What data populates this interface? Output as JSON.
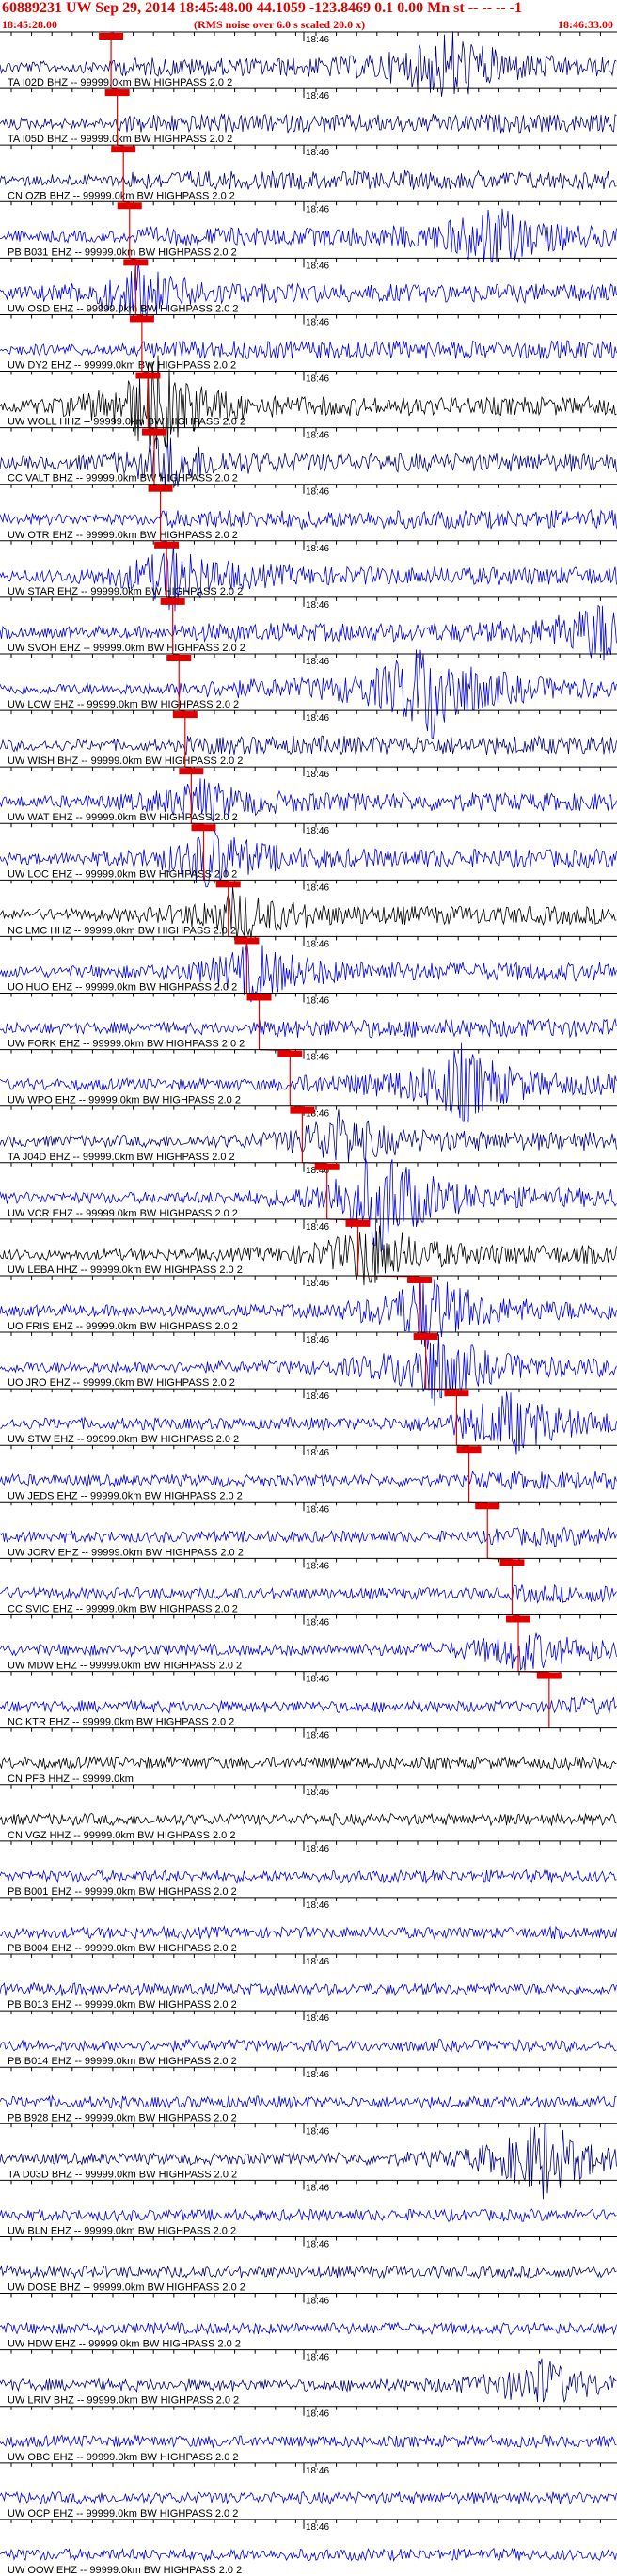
{
  "header": {
    "title": "60889231 UW Sep 29, 2014 18:45:48.00   44.1059 -123.8469  0.1 0.00 Mn st -- -- --  -1",
    "start_time": "18:45:28.00",
    "noise_note": "(RMS noise over 6.0 s scaled 20.0 x)",
    "end_time": "18:46:33.00",
    "tick_label": "18:46",
    "colors": {
      "header_text": "#e00000",
      "pick_marker": "#e00000"
    }
  },
  "traces": [
    {
      "label": "TA I02D BHZ -- 99999.0km BW  HIGHPASS  2.0  2",
      "color": "#000080",
      "pick": 0.18,
      "burst": 0.73,
      "burstAmp": 1.8
    },
    {
      "label": "TA I05D BHZ -- 99999.0km BW  HIGHPASS  2.0  2",
      "color": "#000080",
      "pick": 0.19,
      "burst": null,
      "burstAmp": 0
    },
    {
      "label": "CN OZB BHZ -- 99999.0km BW  HIGHPASS  2.0  2",
      "color": "#000080",
      "pick": 0.2,
      "burst": null,
      "burstAmp": 0
    },
    {
      "label": "PB B031 EHZ -- 99999.0km BW  HIGHPASS  2.0  2",
      "color": "#0000e0",
      "pick": 0.21,
      "burst": 0.8,
      "burstAmp": 1.5
    },
    {
      "label": "UW OSD EHZ -- 99999.0km BW  HIGHPASS  2.0  2",
      "color": "#0000e0",
      "pick": 0.22,
      "burst": 0.22,
      "burstAmp": 1.4
    },
    {
      "label": "UW DY2 EHZ -- 99999.0km BW  HIGHPASS  2.0  2",
      "color": "#0000e0",
      "pick": 0.23,
      "burst": null,
      "burstAmp": 0
    },
    {
      "label": "UW WOLL HHZ -- 99999.0km BW  HIGHPASS  2.0  2",
      "color": "#000000",
      "pick": 0.24,
      "burst": 0.25,
      "burstAmp": 2.6
    },
    {
      "label": "CC VALT BHZ -- 99999.0km BW  HIGHPASS  2.0  2",
      "color": "#000080",
      "pick": 0.25,
      "burst": 0.27,
      "burstAmp": 1.2
    },
    {
      "label": "UW OTR EHZ -- 99999.0km BW  HIGHPASS  2.0  2",
      "color": "#0000e0",
      "pick": 0.26,
      "burst": null,
      "burstAmp": 0
    },
    {
      "label": "UW STAR EHZ -- 99999.0km BW  HIGHPASS  2.0  2",
      "color": "#0000e0",
      "pick": 0.27,
      "burst": 0.28,
      "burstAmp": 1.6
    },
    {
      "label": "UW SVOH EHZ -- 99999.0km BW  HIGHPASS  2.0  2",
      "color": "#0000e0",
      "pick": 0.28,
      "burst": 0.98,
      "burstAmp": 1.5
    },
    {
      "label": "UW LCW EHZ -- 99999.0km BW  HIGHPASS  2.0  2",
      "color": "#0000e0",
      "pick": 0.29,
      "burst": 0.7,
      "burstAmp": 2.8
    },
    {
      "label": "UW WISH BHZ -- 99999.0km BW  HIGHPASS  2.0  2",
      "color": "#000080",
      "pick": 0.3,
      "burst": null,
      "burstAmp": 0
    },
    {
      "label": "UW WAT EHZ -- 99999.0km BW  HIGHPASS  2.0  2",
      "color": "#0000e0",
      "pick": 0.31,
      "burst": 0.32,
      "burstAmp": 1.0
    },
    {
      "label": "UW LOC EHZ -- 99999.0km BW  HIGHPASS  2.0  2",
      "color": "#0000e0",
      "pick": 0.33,
      "burst": 0.34,
      "burstAmp": 1.5
    },
    {
      "label": "NC LMC HHZ -- 99999.0km BW  HIGHPASS  2.0  2",
      "color": "#000000",
      "pick": 0.37,
      "burst": 0.38,
      "burstAmp": 1.2
    },
    {
      "label": "UO HUO EHZ -- 99999.0km BW  HIGHPASS  2.0  2",
      "color": "#0000e0",
      "pick": 0.4,
      "burst": 0.41,
      "burstAmp": 1.4
    },
    {
      "label": "UW FORK EHZ -- 99999.0km BW  HIGHPASS  2.0  2",
      "color": "#0000e0",
      "pick": 0.42,
      "burst": null,
      "burstAmp": 0
    },
    {
      "label": "UW WPO EHZ -- 99999.0km BW  HIGHPASS  2.0  2",
      "color": "#0000e0",
      "pick": 0.47,
      "burst": 0.75,
      "burstAmp": 1.9
    },
    {
      "label": "TA J04D BHZ -- 99999.0km BW  HIGHPASS  2.0  2",
      "color": "#000080",
      "pick": 0.49,
      "burst": 0.55,
      "burstAmp": 1.3
    },
    {
      "label": "UW VCR EHZ -- 99999.0km BW  HIGHPASS  2.0  2",
      "color": "#0000e0",
      "pick": 0.53,
      "burst": 0.62,
      "burstAmp": 2.8
    },
    {
      "label": "UW LEBA HHZ -- 99999.0km BW  HIGHPASS  2.0  2",
      "color": "#000000",
      "pick": 0.58,
      "burst": 0.6,
      "burstAmp": 1.6
    },
    {
      "label": "UO FRIS EHZ -- 99999.0km BW  HIGHPASS  2.0  2",
      "color": "#0000e0",
      "pick": 0.68,
      "burst": 0.69,
      "burstAmp": 2.0
    },
    {
      "label": "UO JRO EHZ -- 99999.0km BW  HIGHPASS  2.0  2",
      "color": "#0000e0",
      "pick": 0.69,
      "burst": 0.7,
      "burstAmp": 2.0
    },
    {
      "label": "UW STW EHZ -- 99999.0km BW  HIGHPASS  2.0  2",
      "color": "#0000e0",
      "pick": 0.74,
      "burst": 0.83,
      "burstAmp": 1.5
    },
    {
      "label": "UW JEDS EHZ -- 99999.0km BW  HIGHPASS  2.0  2",
      "color": "#0000e0",
      "pick": 0.76,
      "burst": null,
      "burstAmp": 0
    },
    {
      "label": "UW JORV EHZ -- 99999.0km BW  HIGHPASS  2.0  2",
      "color": "#0000e0",
      "pick": 0.79,
      "burst": null,
      "burstAmp": 0
    },
    {
      "label": "CC SVIC EHZ -- 99999.0km BW  HIGHPASS  2.0  2",
      "color": "#0000e0",
      "pick": 0.83,
      "burst": null,
      "burstAmp": 0
    },
    {
      "label": "UW MDW EHZ -- 99999.0km BW  HIGHPASS  2.0  2",
      "color": "#0000e0",
      "pick": 0.84,
      "burst": 0.84,
      "burstAmp": 0.9
    },
    {
      "label": "NC KTR EHZ -- 99999.0km BW  HIGHPASS  2.0  2",
      "color": "#0000e0",
      "pick": 0.89,
      "burst": null,
      "burstAmp": 0
    },
    {
      "label": "CN PFB HHZ -- 99999.0km",
      "color": "#000000",
      "pick": null,
      "burst": null,
      "burstAmp": 0
    },
    {
      "label": "CN VGZ HHZ -- 99999.0km BW  HIGHPASS  2.0  2",
      "color": "#000000",
      "pick": null,
      "burst": null,
      "burstAmp": 0
    },
    {
      "label": "PB B001 EHZ -- 99999.0km BW  HIGHPASS  2.0  2",
      "color": "#0000e0",
      "pick": null,
      "burst": null,
      "burstAmp": 0
    },
    {
      "label": "PB B004 EHZ -- 99999.0km BW  HIGHPASS  2.0  2",
      "color": "#0000e0",
      "pick": null,
      "burst": null,
      "burstAmp": 0
    },
    {
      "label": "PB B013 EHZ -- 99999.0km BW  HIGHPASS  2.0  2",
      "color": "#0000e0",
      "pick": null,
      "burst": null,
      "burstAmp": 0
    },
    {
      "label": "PB B014 EHZ -- 99999.0km BW  HIGHPASS  2.0  2",
      "color": "#0000e0",
      "pick": null,
      "burst": null,
      "burstAmp": 0
    },
    {
      "label": "PB B928 EHZ -- 99999.0km BW  HIGHPASS  2.0  2",
      "color": "#0000e0",
      "pick": null,
      "burst": null,
      "burstAmp": 0
    },
    {
      "label": "TA D03D BHZ -- 99999.0km BW  HIGHPASS  2.0  2",
      "color": "#000080",
      "pick": null,
      "burst": 0.88,
      "burstAmp": 2.2
    },
    {
      "label": "UW BLN EHZ -- 99999.0km BW  HIGHPASS  2.0  2",
      "color": "#0000e0",
      "pick": null,
      "burst": null,
      "burstAmp": 0
    },
    {
      "label": "UW DOSE BHZ -- 99999.0km BW  HIGHPASS  2.0  2",
      "color": "#000080",
      "pick": null,
      "burst": null,
      "burstAmp": 0
    },
    {
      "label": "UW HDW EHZ -- 99999.0km BW  HIGHPASS  2.0  2",
      "color": "#0000e0",
      "pick": null,
      "burst": null,
      "burstAmp": 0
    },
    {
      "label": "UW LRIV BHZ -- 99999.0km BW  HIGHPASS  2.0  2",
      "color": "#000080",
      "pick": null,
      "burst": 0.88,
      "burstAmp": 1.3
    },
    {
      "label": "UW OBC EHZ -- 99999.0km BW  HIGHPASS  2.0  2",
      "color": "#0000e0",
      "pick": null,
      "burst": null,
      "burstAmp": 0
    },
    {
      "label": "UW OCP EHZ -- 99999.0km BW  HIGHPASS  2.0  2",
      "color": "#0000e0",
      "pick": null,
      "burst": null,
      "burstAmp": 0
    },
    {
      "label": "UW OOW EHZ -- 99999.0km BW  HIGHPASS  2.0  2",
      "color": "#0000e0",
      "pick": null,
      "burst": null,
      "burstAmp": 0
    }
  ]
}
